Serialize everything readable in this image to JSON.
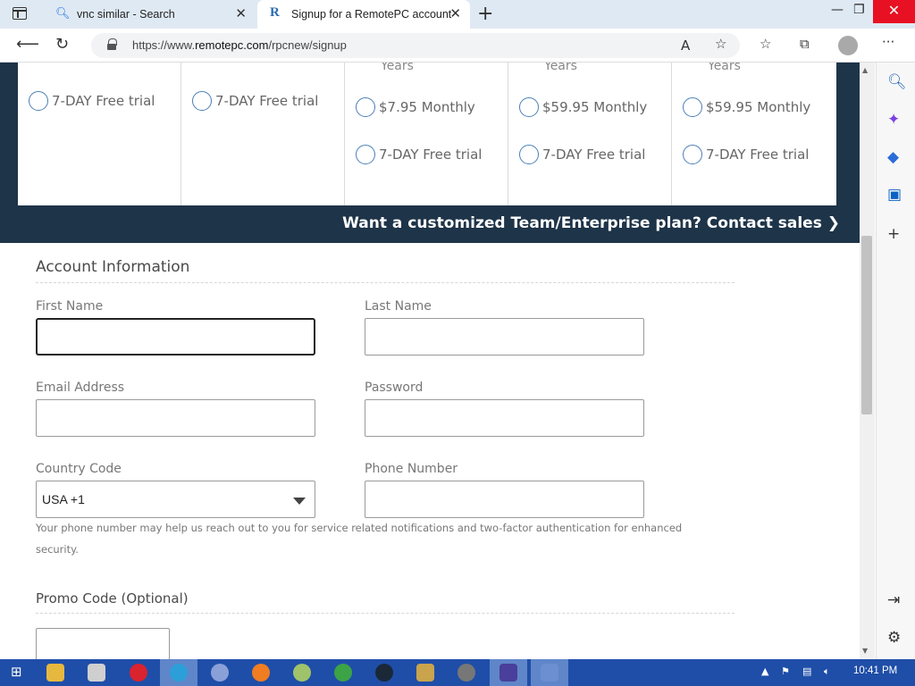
{
  "browser": {
    "tabs": [
      {
        "label": "vnc similar - Search",
        "icon": "search-icon"
      },
      {
        "label": "Signup for a RemotePC account",
        "icon": "remotepc-logo-icon"
      }
    ],
    "url_prefix": "https://www.",
    "url_domain": "remotepc.com",
    "url_path": "/rpcnew/signup"
  },
  "plans": {
    "years_label": "Years",
    "columns": [
      {
        "options": [
          "7-DAY Free trial"
        ]
      },
      {
        "options": [
          "7-DAY Free trial"
        ]
      },
      {
        "options": [
          "$7.95 Monthly",
          "7-DAY Free trial"
        ]
      },
      {
        "options": [
          "$59.95 Monthly",
          "7-DAY Free trial"
        ]
      },
      {
        "options": [
          "$59.95 Monthly",
          "7-DAY Free trial"
        ]
      }
    ],
    "contact_sales": "Want a customized Team/Enterprise plan? Contact sales ❯"
  },
  "account": {
    "title": "Account Information",
    "first_name_label": "First Name",
    "last_name_label": "Last Name",
    "email_label": "Email Address",
    "password_label": "Password",
    "country_code_label": "Country Code",
    "country_code_value": "USA +1",
    "phone_label": "Phone Number",
    "phone_helper": "Your phone number may help us reach out to you for service related notifications and two-factor authentication for enhanced security."
  },
  "promo": {
    "title": "Promo Code (Optional)"
  },
  "taskbar": {
    "time": "10:41 PM"
  },
  "colors": {
    "band": "#1e3449",
    "radio": "#4a7fb5",
    "taskbar": "#1f4ea8"
  }
}
